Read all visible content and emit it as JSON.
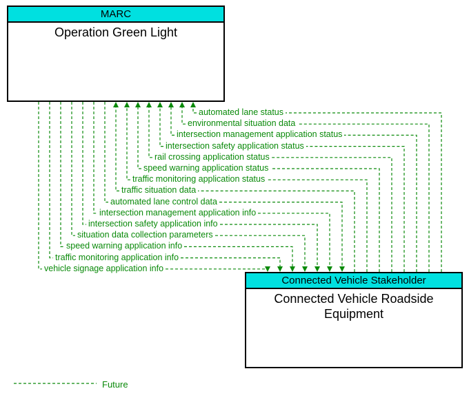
{
  "boxes": {
    "top": {
      "header": "MARC",
      "title": "Operation Green Light"
    },
    "bottom": {
      "header": "Connected Vehicle Stakeholder",
      "title": "Connected Vehicle Roadside Equipment"
    }
  },
  "flows_up": [
    "automated lane status",
    "environmental situation data",
    "intersection management application status",
    "intersection safety application status",
    "rail crossing application status",
    "speed warning application status",
    "traffic monitoring application status",
    "traffic situation data"
  ],
  "flows_down": [
    "automated lane control data",
    "intersection management application info",
    "intersection safety application info",
    "situation data collection parameters",
    "speed warning application info",
    "traffic monitoring application info",
    "vehicle signage application info"
  ],
  "legend": {
    "future": "Future"
  },
  "colors": {
    "flow_line": "#0a8a0a",
    "header_bg": "#00e0e0"
  }
}
